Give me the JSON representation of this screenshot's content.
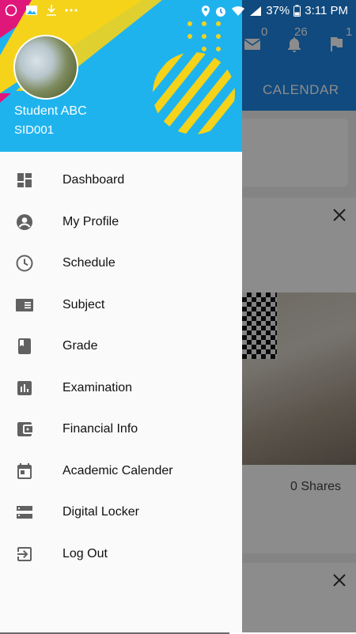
{
  "status_bar": {
    "battery": "37%",
    "time": "3:11 PM",
    "left_icons": [
      "whatsapp-icon",
      "gallery-icon",
      "download-icon",
      "more-icon"
    ],
    "right_icons": [
      "location-icon",
      "alarm-icon",
      "wifi-icon",
      "signal-icon",
      "battery-icon"
    ]
  },
  "background_app": {
    "header_counts": {
      "mail": "0",
      "notifications": "26",
      "flags": "1"
    },
    "tab_label": "CALENDAR",
    "shares_text": "0 Shares",
    "colors": {
      "header": "#1e88e5"
    }
  },
  "drawer": {
    "user": {
      "name": "Student ABC",
      "id": "SID001"
    },
    "colors": {
      "header": "#1fb3ee",
      "accent_yellow": "#f5d31a",
      "accent_pink": "#e0177a"
    },
    "menu": [
      {
        "label": "Dashboard",
        "icon": "dashboard-icon"
      },
      {
        "label": "My Profile",
        "icon": "account-circle-icon"
      },
      {
        "label": "Schedule",
        "icon": "clock-icon"
      },
      {
        "label": "Subject",
        "icon": "subject-icon"
      },
      {
        "label": "Grade",
        "icon": "book-icon"
      },
      {
        "label": "Examination",
        "icon": "bar-chart-icon"
      },
      {
        "label": "Financial Info",
        "icon": "wallet-icon"
      },
      {
        "label": "Academic Calender",
        "icon": "calendar-icon"
      },
      {
        "label": "Digital Locker",
        "icon": "storage-icon"
      },
      {
        "label": "Log Out",
        "icon": "logout-icon"
      }
    ]
  }
}
